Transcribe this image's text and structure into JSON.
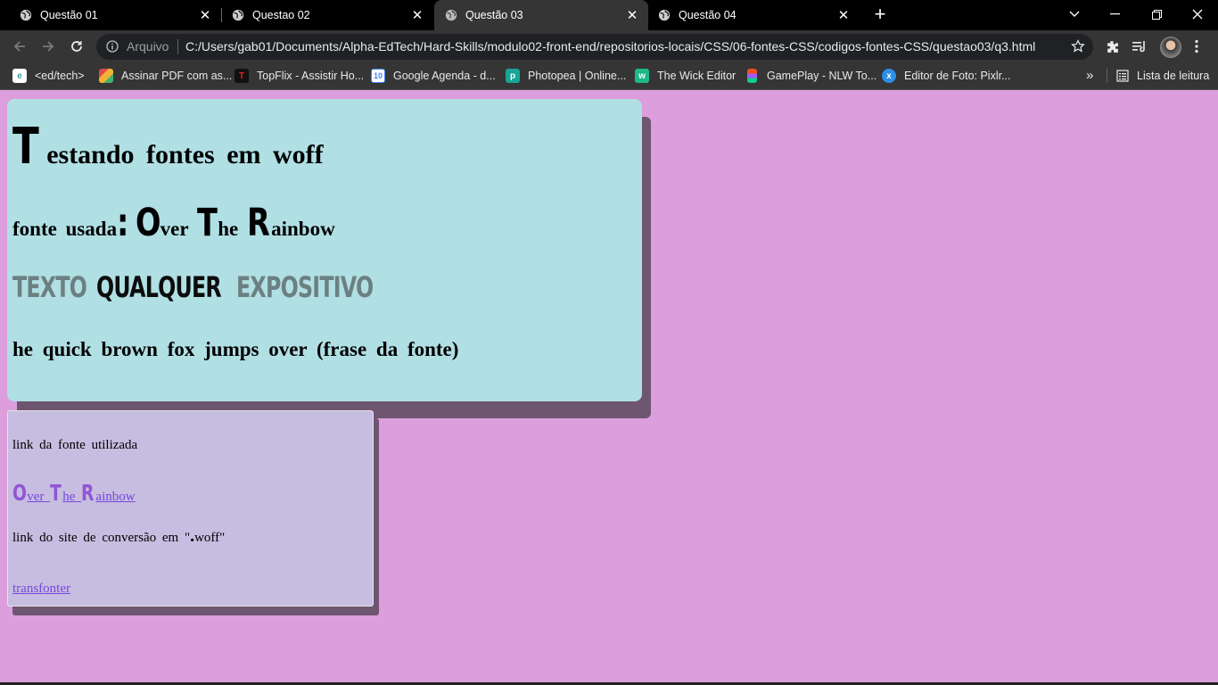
{
  "tabs": [
    {
      "title": "Questão 01"
    },
    {
      "title": "Questao 02"
    },
    {
      "title": "Questão 03"
    },
    {
      "title": "Questão 04"
    }
  ],
  "omnibox": {
    "scheme_label": "Arquivo",
    "url": "C:/Users/gab01/Documents/Alpha-EdTech/Hard-Skills/modulo02-front-end/repositorios-locais/CSS/06-fontes-CSS/codigos-fontes-CSS/questao03/q3.html"
  },
  "bookmarks": [
    {
      "label": "<ed/tech>",
      "icon": "edtech-icon",
      "color": "#3aa0a0"
    },
    {
      "label": "Assinar PDF com as...",
      "icon": "pdf-sign-icon",
      "color": "#e04a4a"
    },
    {
      "label": "TopFlix - Assistir Ho...",
      "icon": "topflix-icon",
      "color": "#111111"
    },
    {
      "label": "Google Agenda - d...",
      "icon": "calendar-icon",
      "color": "#4285f4"
    },
    {
      "label": "Photopea | Online...",
      "icon": "photopea-icon",
      "color": "#18a497"
    },
    {
      "label": "The Wick Editor",
      "icon": "wick-icon",
      "color": "#1db98a"
    },
    {
      "label": "GamePlay - NLW To...",
      "icon": "figma-icon",
      "color": "#f24e1e"
    },
    {
      "label": "Editor de Foto: Pixlr...",
      "icon": "pixlr-icon",
      "color": "#2d8ee8"
    }
  ],
  "reading_list_label": "Lista de leitura",
  "page": {
    "heading1": {
      "first": "T",
      "rest": "estando fontes em woff"
    },
    "heading2": {
      "prefix": "fonte usada",
      "colon": ":",
      "w1_cap": "O",
      "w1_rest": "ver",
      "w2_cap": "T",
      "w2_rest": "he",
      "w3_cap": "R",
      "w3_rest": "ainbow"
    },
    "heading3": {
      "seg1": "TEXTO",
      "seg2": "QUALQUER",
      "seg3": "EXPOSITIVO"
    },
    "heading4": "he quick brown fox jumps over (frase da fonte)",
    "font_link_label": "link da fonte utilizada",
    "font_link": {
      "w1_cap": "O",
      "w1_rest": "ver",
      "w2_cap": "T",
      "w2_rest": "he",
      "w3_cap": "R",
      "w3_rest": "ainbow"
    },
    "site_link_label_prefix": "link do site de conversão em \"",
    "site_link_label_dot": ".",
    "site_link_label_suffix": "woff\"",
    "site_link": "transfonter"
  },
  "colors": {
    "page_background": "#dc9edc",
    "card1_background": "#b0dfe4",
    "card2_background": "#c6bde0",
    "link": "#7848dc"
  }
}
